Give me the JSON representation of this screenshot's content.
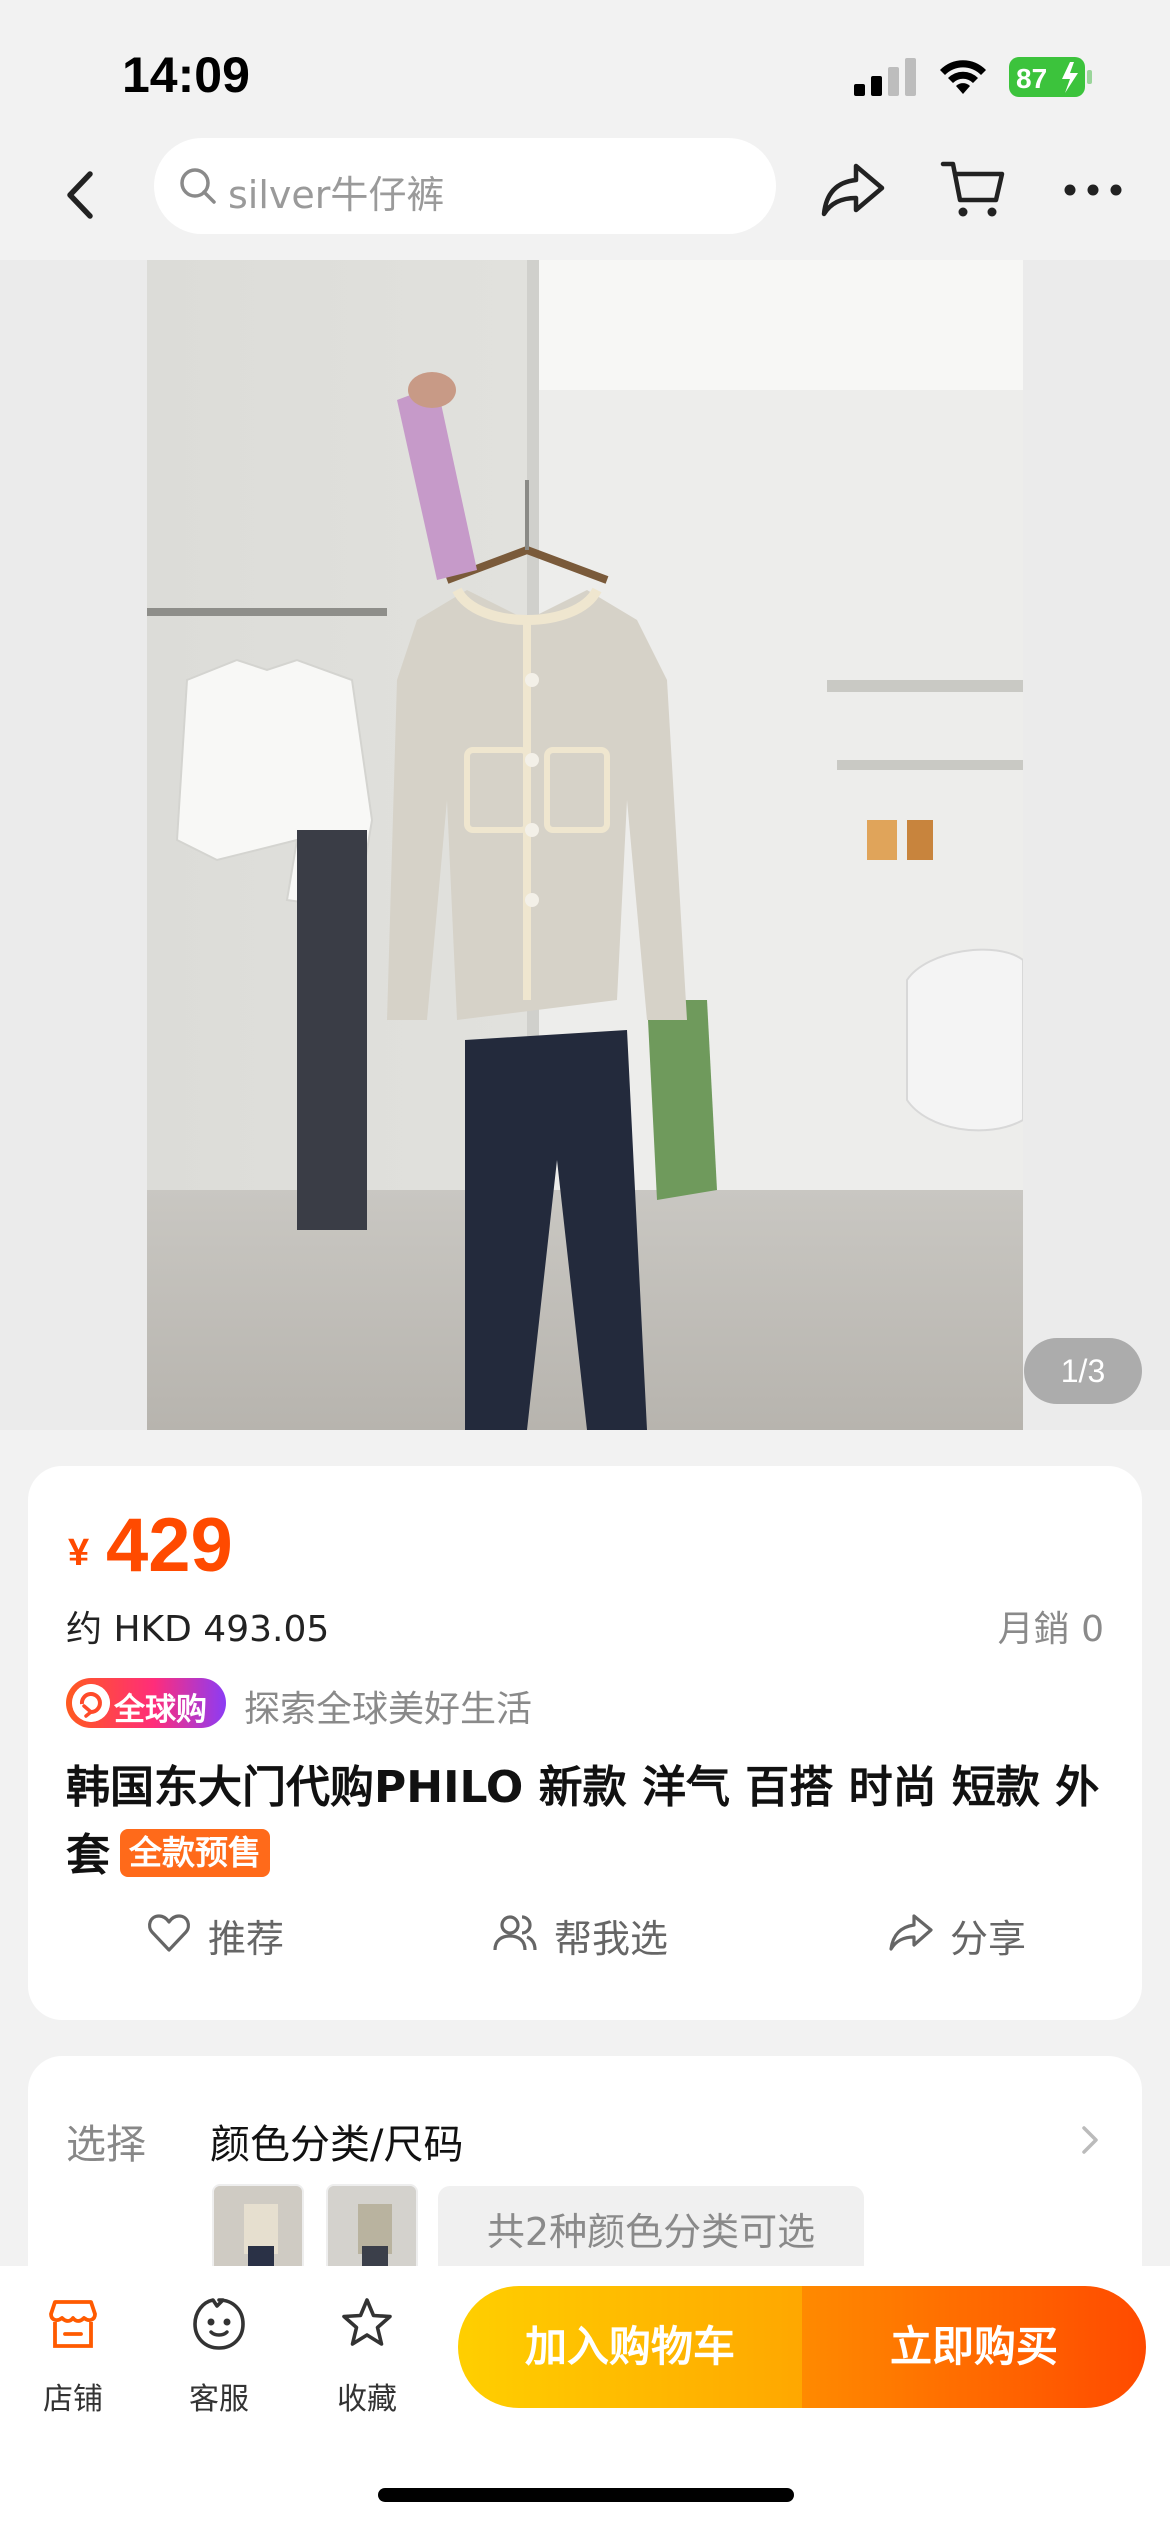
{
  "status_bar": {
    "time": "14:09",
    "battery": "87"
  },
  "nav": {
    "search_placeholder": "silver牛仔裤"
  },
  "gallery": {
    "page_indicator": "1/3"
  },
  "product": {
    "currency_symbol": "¥",
    "price": "429",
    "price_hkd": "约 HKD 493.05",
    "monthly_sales": "月銷 0",
    "global_badge": "全球购",
    "slogan": "探索全球美好生活",
    "title": "韩国东大门代购PHILO  新款 洋气 百搭 时尚 短款 外套",
    "presale_tag": "全款预售"
  },
  "actions": {
    "recommend": "推荐",
    "help_me_choose": "帮我选",
    "share": "分享"
  },
  "options": {
    "label": "选择",
    "value": "颜色分类/尺码",
    "color_count": "共2种颜色分类可选"
  },
  "bottom_bar": {
    "store": "店铺",
    "service": "客服",
    "favorite": "收藏",
    "add_to_cart": "加入购物车",
    "buy_now": "立即购买"
  },
  "colors": {
    "accent": "#ff4a00",
    "cart_button": "#ffb800",
    "buy_button": "#ff5a00"
  }
}
